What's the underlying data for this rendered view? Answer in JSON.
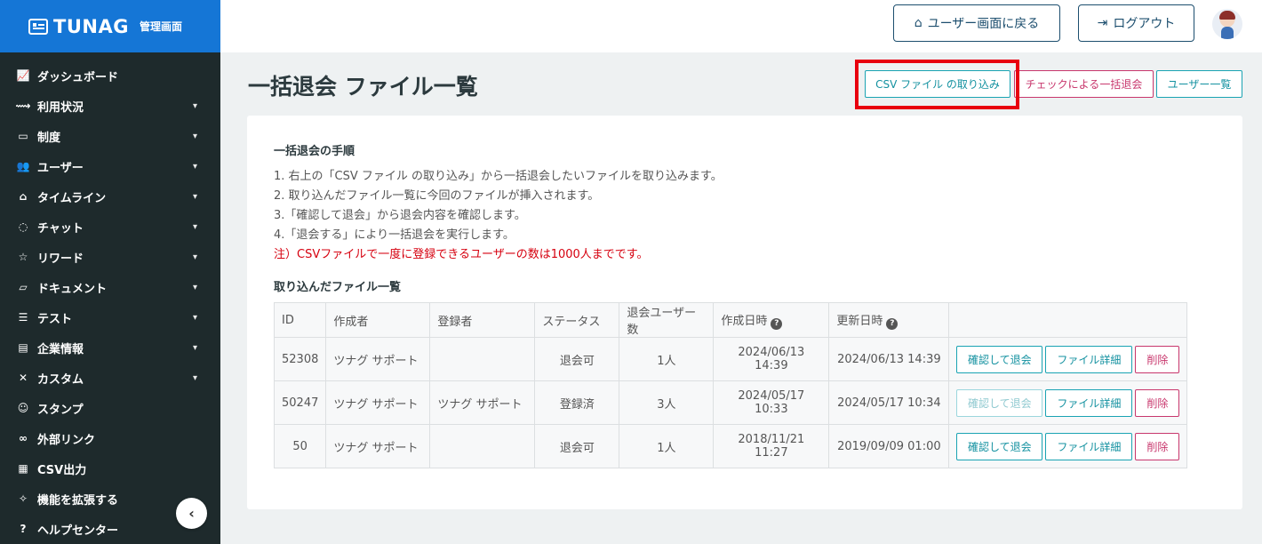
{
  "brand": {
    "name": "TUNAG",
    "sub": "管理画面"
  },
  "sidebar": {
    "items": [
      {
        "label": "ダッシュボード",
        "icon": "chart-line-icon",
        "glyph": "📈",
        "chevron": false
      },
      {
        "label": "利用状況",
        "icon": "pulse-icon",
        "glyph": "⟿",
        "chevron": true
      },
      {
        "label": "制度",
        "icon": "book-icon",
        "glyph": "▭",
        "chevron": true
      },
      {
        "label": "ユーザー",
        "icon": "users-icon",
        "glyph": "👥",
        "chevron": true
      },
      {
        "label": "タイムライン",
        "icon": "home-icon",
        "glyph": "⌂",
        "chevron": true
      },
      {
        "label": "チャット",
        "icon": "chat-icon",
        "glyph": "◌",
        "chevron": true
      },
      {
        "label": "リワード",
        "icon": "star-icon",
        "glyph": "☆",
        "chevron": true
      },
      {
        "label": "ドキュメント",
        "icon": "folder-icon",
        "glyph": "▱",
        "chevron": true
      },
      {
        "label": "テスト",
        "icon": "list-icon",
        "glyph": "☰",
        "chevron": true
      },
      {
        "label": "企業情報",
        "icon": "building-icon",
        "glyph": "▤",
        "chevron": true
      },
      {
        "label": "カスタム",
        "icon": "tools-icon",
        "glyph": "✕",
        "chevron": true
      },
      {
        "label": "スタンプ",
        "icon": "smile-icon",
        "glyph": "☺",
        "chevron": false
      },
      {
        "label": "外部リンク",
        "icon": "link-icon",
        "glyph": "∞",
        "chevron": false
      },
      {
        "label": "CSV出力",
        "icon": "table-icon",
        "glyph": "▦",
        "chevron": false
      },
      {
        "label": "機能を拡張する",
        "icon": "sparkle-icon",
        "glyph": "✧",
        "chevron": false
      },
      {
        "label": "ヘルプセンター",
        "icon": "help-icon",
        "glyph": "?",
        "chevron": false
      }
    ]
  },
  "header": {
    "back_label": "ユーザー画面に戻る",
    "logout_label": "ログアウト"
  },
  "page": {
    "title": "一括退会 ファイル一覧",
    "btn_import": "CSV ファイル の取り込み",
    "btn_check": "チェックによる一括退会",
    "btn_users": "ユーザー一覧"
  },
  "procedure": {
    "title": "一括退会の手順",
    "steps": [
      "1. 右上の「CSV ファイル の取り込み」から一括退会したいファイルを取り込みます。",
      "2. 取り込んだファイル一覧に今回のファイルが挿入されます。",
      "3.「確認して退会」から退会内容を確認します。",
      "4.「退会する」により一括退会を実行します。"
    ],
    "warning": "注）CSVファイルで一度に登録できるユーザーの数は1000人までです。"
  },
  "files": {
    "title": "取り込んだファイル一覧",
    "columns": [
      "ID",
      "作成者",
      "登録者",
      "ステータス",
      "退会ユーザー数",
      "作成日時",
      "更新日時",
      ""
    ],
    "rows": [
      {
        "id": "52308",
        "creator": "ツナグ サポート",
        "registrant": "",
        "status": "退会可",
        "count": "1人",
        "created": "2024/06/13 14:39",
        "updated": "2024/06/13 14:39",
        "confirm_enabled": true
      },
      {
        "id": "50247",
        "creator": "ツナグ サポート",
        "registrant": "ツナグ サポート",
        "status": "登録済",
        "count": "3人",
        "created": "2024/05/17 10:33",
        "updated": "2024/05/17 10:34",
        "confirm_enabled": false
      },
      {
        "id": "50",
        "creator": "ツナグ サポート",
        "registrant": "",
        "status": "退会可",
        "count": "1人",
        "created": "2018/11/21 11:27",
        "updated": "2019/09/09 01:00",
        "confirm_enabled": true
      }
    ],
    "actions": {
      "confirm": "確認して退会",
      "detail": "ファイル詳細",
      "delete": "削除"
    }
  },
  "colors": {
    "brand": "#1576d6",
    "sidebar": "#1e2a2c",
    "teal": "#1aa3b3",
    "pink": "#c8376d",
    "warning": "#d6000f",
    "highlight": "#e8000f"
  }
}
